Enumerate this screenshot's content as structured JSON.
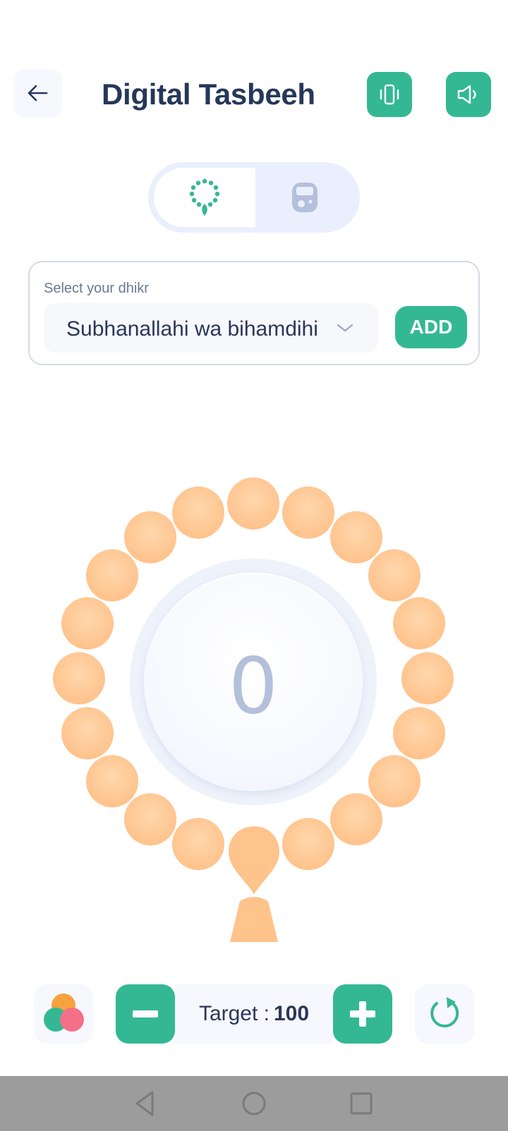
{
  "header": {
    "title": "Digital Tasbeeh",
    "back_icon": "arrow-left-icon",
    "vibration_icon": "vibration-icon",
    "sound_icon": "speaker-icon"
  },
  "mode_toggle": {
    "active": "beads",
    "options": [
      {
        "icon": "prayer-beads-icon"
      },
      {
        "icon": "tally-counter-icon"
      }
    ]
  },
  "dhikr": {
    "label": "Select your dhikr",
    "selected": "Subhanallahi wa bihamdihi",
    "add_label": "ADD"
  },
  "counter": {
    "count": "0"
  },
  "bottom_bar": {
    "target_label": "Target :",
    "target_value": "100",
    "theme_icon": "color-palette-icon",
    "minus_icon": "minus-icon",
    "plus_icon": "plus-icon",
    "reset_icon": "reset-icon"
  },
  "colors": {
    "accent": "#34b894",
    "bead": "#ffc38c",
    "counter_text": "#b4bfdc",
    "title": "#26375a"
  },
  "system_nav": [
    "back-nav-icon",
    "home-nav-icon",
    "recents-nav-icon"
  ]
}
